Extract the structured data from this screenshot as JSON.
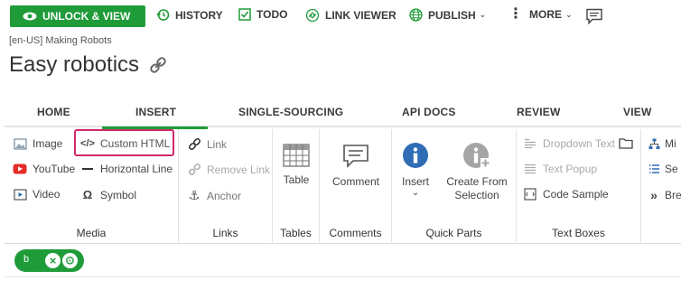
{
  "toolbar": {
    "unlock_label": "UNLOCK & VIEW",
    "history_label": "HISTORY",
    "todo_label": "TODO",
    "link_viewer_label": "LINK VIEWER",
    "publish_label": "PUBLISH",
    "more_label": "MORE",
    "accent_color": "#1f9b3a"
  },
  "breadcrumb": "[en-US] Making Robots",
  "page_title": "Easy robotics",
  "tabs": [
    "HOME",
    "INSERT",
    "SINGLE-SOURCING",
    "API DOCS",
    "REVIEW",
    "VIEW"
  ],
  "active_tab": "INSERT",
  "ribbon": {
    "media": {
      "label": "Media",
      "items": [
        "Image",
        "YouTube",
        "Video",
        "Custom HTML",
        "Horizontal Line",
        "Symbol"
      ]
    },
    "links": {
      "label": "Links",
      "items": [
        "Link",
        "Remove Link",
        "Anchor"
      ]
    },
    "tables": {
      "label": "Tables",
      "button": "Table"
    },
    "comments": {
      "label": "Comments",
      "button": "Comment"
    },
    "quick_parts": {
      "label": "Quick Parts",
      "insert": "Insert",
      "create_line1": "Create From",
      "create_line2": "Selection"
    },
    "text_boxes": {
      "label": "Text Boxes",
      "items": [
        "Dropdown Text",
        "Text Popup",
        "Code Sample"
      ]
    },
    "overflow": [
      "Mi",
      "Se",
      "Bre"
    ]
  },
  "editor": {
    "chip_label": "b"
  }
}
